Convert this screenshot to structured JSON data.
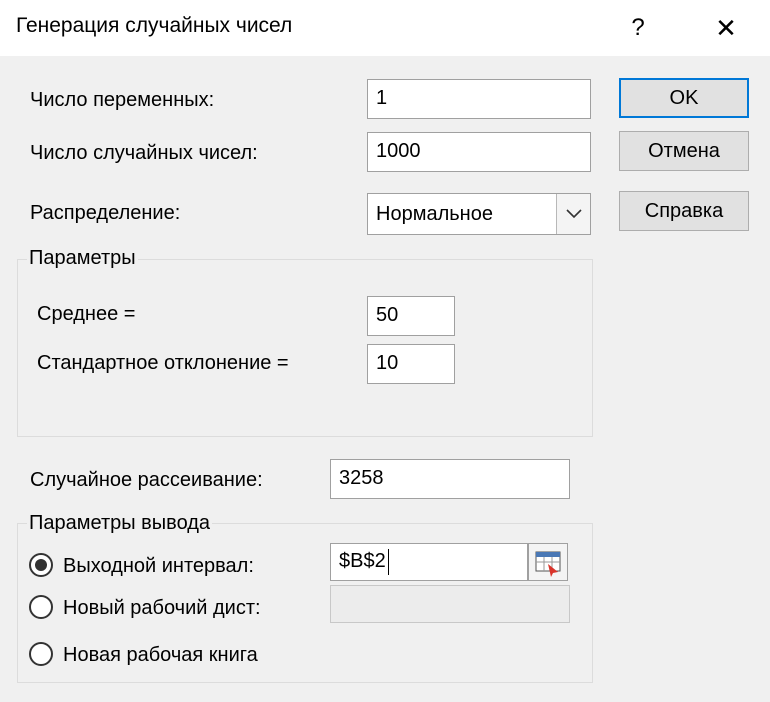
{
  "window": {
    "title": "Генерация случайных чисел",
    "help_glyph": "?",
    "close_glyph": "✕"
  },
  "fields": {
    "num_variables": {
      "label": "Число переменных:",
      "value": "1"
    },
    "num_random": {
      "label": "Число случайных чисел:",
      "value": "1000"
    },
    "distribution": {
      "label": "Распределение:",
      "selected": "Нормальное"
    }
  },
  "parameters": {
    "title": "Параметры",
    "mean": {
      "label": "Среднее =",
      "value": "50"
    },
    "std_dev": {
      "label": "Стандартное отклонение =",
      "value": "10"
    }
  },
  "seed": {
    "label": "Случайное рассеивание:",
    "value": "3258"
  },
  "output": {
    "title": "Параметры вывода",
    "output_range": {
      "label": "Выходной интервал:",
      "value": "$B$2",
      "selected": true
    },
    "new_sheet": {
      "label": "Новый рабочий дист:",
      "value": "",
      "selected": false
    },
    "new_workbook": {
      "label": "Новая рабочая книга",
      "selected": false
    }
  },
  "buttons": {
    "ok": "OK",
    "cancel": "Отмена",
    "help": "Справка"
  },
  "icons": {
    "dropdown": "chevron-down-icon",
    "range_picker": "range-select-icon",
    "help": "question-icon",
    "close": "close-icon"
  }
}
